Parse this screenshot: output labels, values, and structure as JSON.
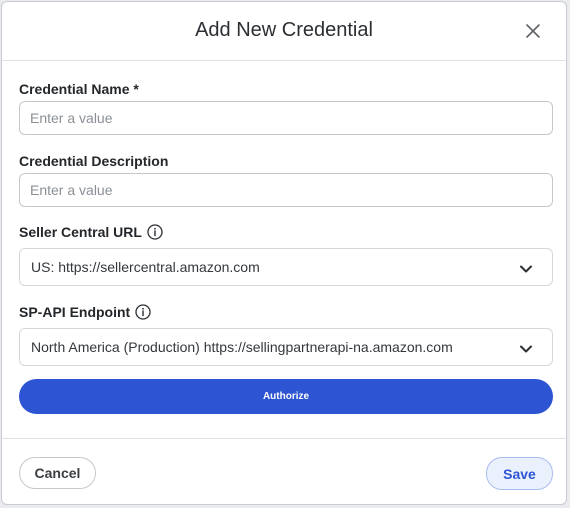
{
  "dialog": {
    "title": "Add New Credential",
    "close_icon": "close-icon"
  },
  "form": {
    "credential_name": {
      "label": "Credential Name *",
      "value": "",
      "placeholder": "Enter a value"
    },
    "credential_description": {
      "label": "Credential Description",
      "value": "",
      "placeholder": "Enter a value"
    },
    "seller_central_url": {
      "label": "Seller Central URL",
      "info_icon": "info-icon",
      "selected": "US: https://sellercentral.amazon.com"
    },
    "sp_api_endpoint": {
      "label": "SP-API Endpoint",
      "info_icon": "info-icon",
      "selected": "North America (Production) https://sellingpartnerapi-na.amazon.com"
    },
    "authorize_label": "Authorize"
  },
  "footer": {
    "cancel_label": "Cancel",
    "save_label": "Save"
  },
  "colors": {
    "primary": "#2d55d3",
    "save_bg": "#eaf1fd",
    "border": "#c4c8cd"
  }
}
